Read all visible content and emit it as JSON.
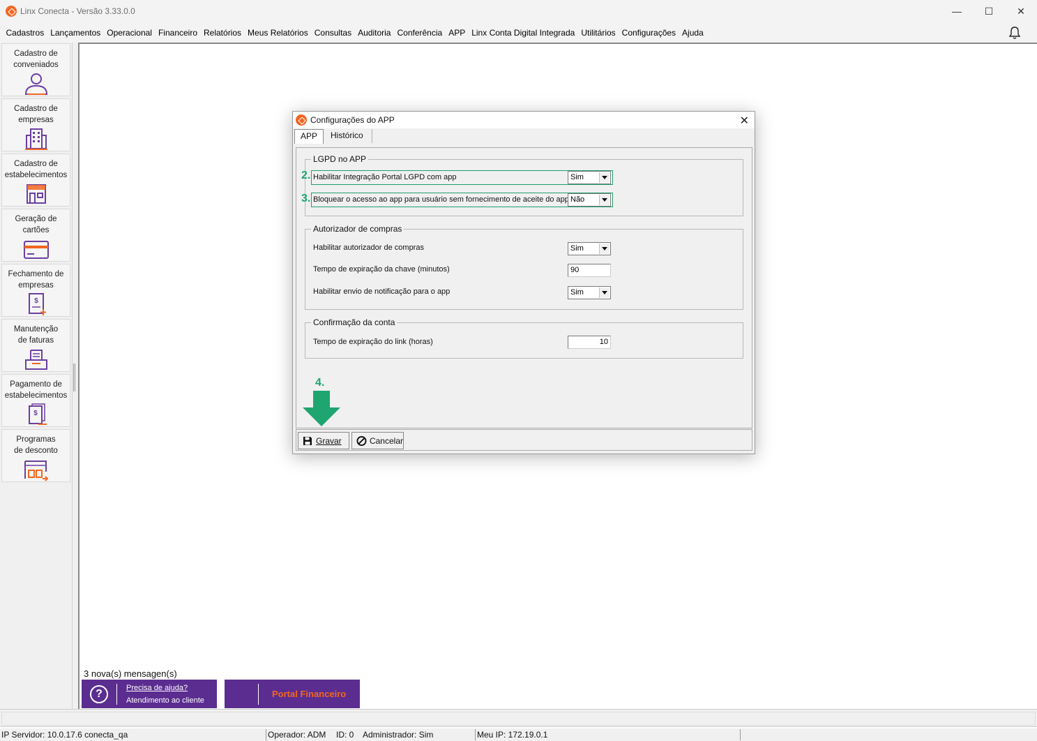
{
  "window": {
    "title": "Linx Conecta - Versão 3.33.0.0",
    "controls": {
      "minimize": "—",
      "maximize": "☐",
      "close": "✕"
    }
  },
  "menu": [
    "Cadastros",
    "Lançamentos",
    "Operacional",
    "Financeiro",
    "Relatórios",
    "Meus Relatórios",
    "Consultas",
    "Auditoria",
    "Conferência",
    "APP",
    "Linx Conta Digital Integrada",
    "Utilitários",
    "Configurações",
    "Ajuda"
  ],
  "sidebar": [
    {
      "label": "Cadastro de\nconveniados",
      "icon": "user-icon"
    },
    {
      "label": "Cadastro de\nempresas",
      "icon": "building-icon"
    },
    {
      "label": "Cadastro de\nestabelecimentos",
      "icon": "store-icon"
    },
    {
      "label": "Geração de\ncartões",
      "icon": "card-icon"
    },
    {
      "label": "Fechamento de\nempresas",
      "icon": "invoice-add-icon"
    },
    {
      "label": "Manutenção\nde faturas",
      "icon": "inbox-icon"
    },
    {
      "label": "Pagamento de\nestabelecimentos",
      "icon": "payment-doc-icon"
    },
    {
      "label": "Programas\nde desconto",
      "icon": "discount-icon"
    }
  ],
  "dialog": {
    "title": "Configurações do APP",
    "close": "✕",
    "tabs": [
      "APP",
      "Histórico"
    ],
    "lgpd": {
      "legend": "LGPD no APP",
      "rows": [
        {
          "step": "2.",
          "label": "Habilitar Integração Portal LGPD com app",
          "value": "Sim"
        },
        {
          "step": "3.",
          "label": "Bloquear o acesso ao app para usuário sem fornecimento de aceite do app",
          "value": "Não"
        }
      ]
    },
    "autorizador": {
      "legend": "Autorizador de compras",
      "rows": [
        {
          "label": "Habilitar autorizador de compras",
          "value": "Sim"
        },
        {
          "label": "Tempo de expiração da chave (minutos)",
          "value": "90"
        },
        {
          "label": "Habilitar envio de notificação para o app",
          "value": "Sim"
        }
      ]
    },
    "confirmacao": {
      "legend": "Confirmação da conta",
      "rows": [
        {
          "label": "Tempo de expiração do link (horas)",
          "value": "10"
        }
      ]
    },
    "step4": "4.",
    "buttons": {
      "save": "Gravar",
      "cancel": "Cancelar"
    }
  },
  "messages": "3 nova(s) mensagen(s)",
  "help": {
    "line1": "Precisa de ajuda?",
    "line2": "Atendimento ao cliente",
    "icon": "?"
  },
  "portal": "Portal Financeiro",
  "status": {
    "server": "IP Servidor: 10.0.17.6 conecta_qa",
    "operator": "Operador: ADM",
    "id": "ID: 0",
    "admin": "Administrador: Sim",
    "ip": "Meu IP: 172.19.0.1"
  },
  "colors": {
    "brand_orange": "#f26722",
    "brand_purple": "#5b2d90",
    "highlight_green": "#1fa56f",
    "icon_purple": "#6b3fa0"
  }
}
